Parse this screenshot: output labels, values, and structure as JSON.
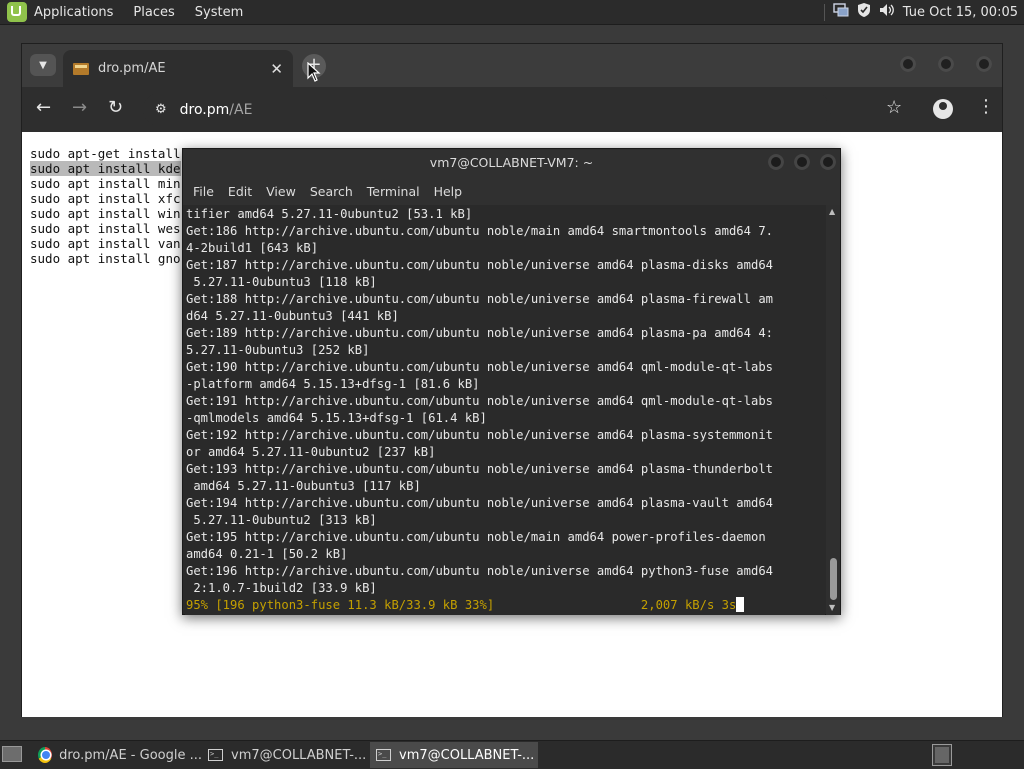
{
  "top_panel": {
    "menu": [
      "Applications",
      "Places",
      "System"
    ],
    "clock": "Tue Oct 15, 00:05",
    "tray_icons": [
      "network-icon",
      "shield-icon",
      "volume-icon"
    ]
  },
  "browser": {
    "tab_title": "dro.pm/AE",
    "url_host": "dro.pm",
    "url_path": "/AE",
    "page_lines": [
      "sudo apt-get install",
      "sudo apt install kde",
      "sudo apt install min",
      "sudo apt install xfc",
      "sudo apt install win",
      "sudo apt install wes",
      "sudo apt install van",
      "sudo apt install gno"
    ]
  },
  "terminal": {
    "title": "vm7@COLLABNET-VM7: ~",
    "menu": [
      "File",
      "Edit",
      "View",
      "Search",
      "Terminal",
      "Help"
    ],
    "output": "tifier amd64 5.27.11-0ubuntu2 [53.1 kB]\nGet:186 http://archive.ubuntu.com/ubuntu noble/main amd64 smartmontools amd64 7.\n4-2build1 [643 kB]\nGet:187 http://archive.ubuntu.com/ubuntu noble/universe amd64 plasma-disks amd64\n 5.27.11-0ubuntu3 [118 kB]\nGet:188 http://archive.ubuntu.com/ubuntu noble/universe amd64 plasma-firewall am\nd64 5.27.11-0ubuntu3 [441 kB]\nGet:189 http://archive.ubuntu.com/ubuntu noble/universe amd64 plasma-pa amd64 4:\n5.27.11-0ubuntu3 [252 kB]\nGet:190 http://archive.ubuntu.com/ubuntu noble/universe amd64 qml-module-qt-labs\n-platform amd64 5.15.13+dfsg-1 [81.6 kB]\nGet:191 http://archive.ubuntu.com/ubuntu noble/universe amd64 qml-module-qt-labs\n-qmlmodels amd64 5.15.13+dfsg-1 [61.4 kB]\nGet:192 http://archive.ubuntu.com/ubuntu noble/universe amd64 plasma-systemmonit\nor amd64 5.27.11-0ubuntu2 [237 kB]\nGet:193 http://archive.ubuntu.com/ubuntu noble/universe amd64 plasma-thunderbolt\n amd64 5.27.11-0ubuntu3 [117 kB]\nGet:194 http://archive.ubuntu.com/ubuntu noble/universe amd64 plasma-vault amd64\n 5.27.11-0ubuntu2 [313 kB]\nGet:195 http://archive.ubuntu.com/ubuntu noble/main amd64 power-profiles-daemon\namd64 0.21-1 [50.2 kB]\nGet:196 http://archive.ubuntu.com/ubuntu noble/universe amd64 python3-fuse amd64\n 2:1.0.7-1build2 [33.9 kB]",
    "progress_line": "95% [196 python3-fuse 11.3 kB/33.9 kB 33%]                    2,007 kB/s 3s"
  },
  "taskbar": {
    "tasks": [
      {
        "label": "dro.pm/AE - Google ...",
        "active": false
      },
      {
        "label": "vm7@COLLABNET-...",
        "active": false
      },
      {
        "label": "vm7@COLLABNET-...",
        "active": true
      }
    ]
  },
  "colors": {
    "progress_text": "#c4a000",
    "panel_bg": "#2b2b2b",
    "terminal_bg": "#2a2a2a"
  }
}
